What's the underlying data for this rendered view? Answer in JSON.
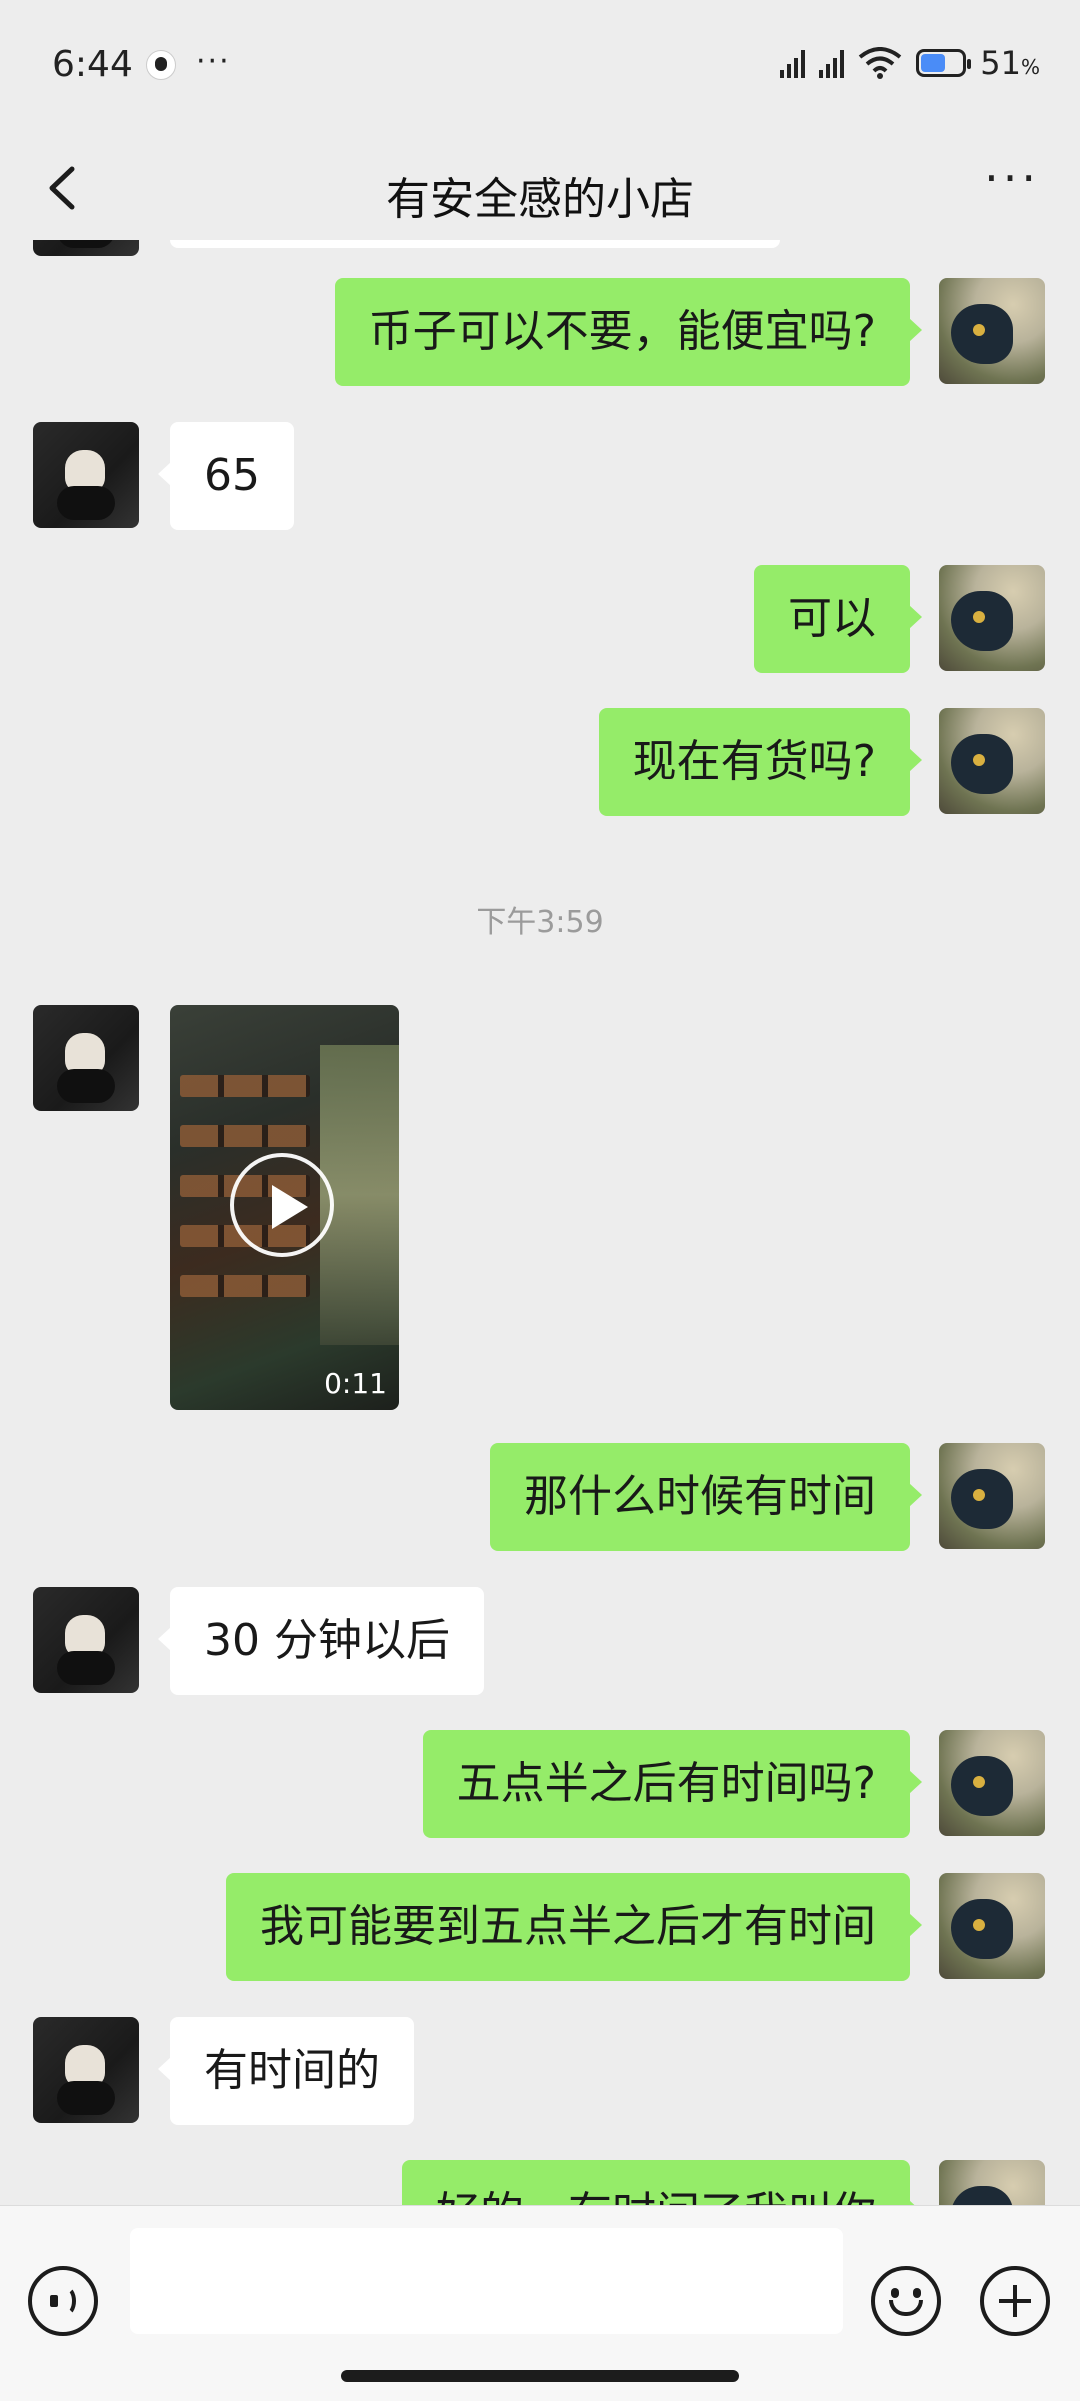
{
  "status_bar": {
    "time": "6:44",
    "more": "···",
    "battery_percent": "51",
    "battery_unit": "%"
  },
  "nav": {
    "title": "有安全感的小店",
    "more": "···"
  },
  "messages": [
    {
      "side": "out",
      "text": "币子可以不要，能便宜吗?"
    },
    {
      "side": "in",
      "text": "65"
    },
    {
      "side": "out",
      "text": "可以"
    },
    {
      "side": "out",
      "text": "现在有货吗?"
    },
    {
      "type": "timestamp",
      "text": "下午3:59"
    },
    {
      "side": "in",
      "type": "video",
      "duration": "0:11"
    },
    {
      "side": "out",
      "text": "那什么时候有时间"
    },
    {
      "side": "in",
      "text": "30 分钟以后"
    },
    {
      "side": "out",
      "text": "五点半之后有时间吗?"
    },
    {
      "side": "out",
      "text": "我可能要到五点半之后才有时间"
    },
    {
      "side": "in",
      "text": "有时间的"
    },
    {
      "side": "out",
      "text": "好的，有时间了我叫你"
    }
  ],
  "input": {
    "value": "",
    "placeholder": ""
  },
  "icons": {
    "back": "chevron-left-icon",
    "more": "more-icon",
    "voice": "voice-icon",
    "emoji": "emoji-icon",
    "plus": "plus-icon"
  },
  "colors": {
    "background": "#ededed",
    "outgoing_bubble": "#95ec69",
    "incoming_bubble": "#ffffff"
  }
}
